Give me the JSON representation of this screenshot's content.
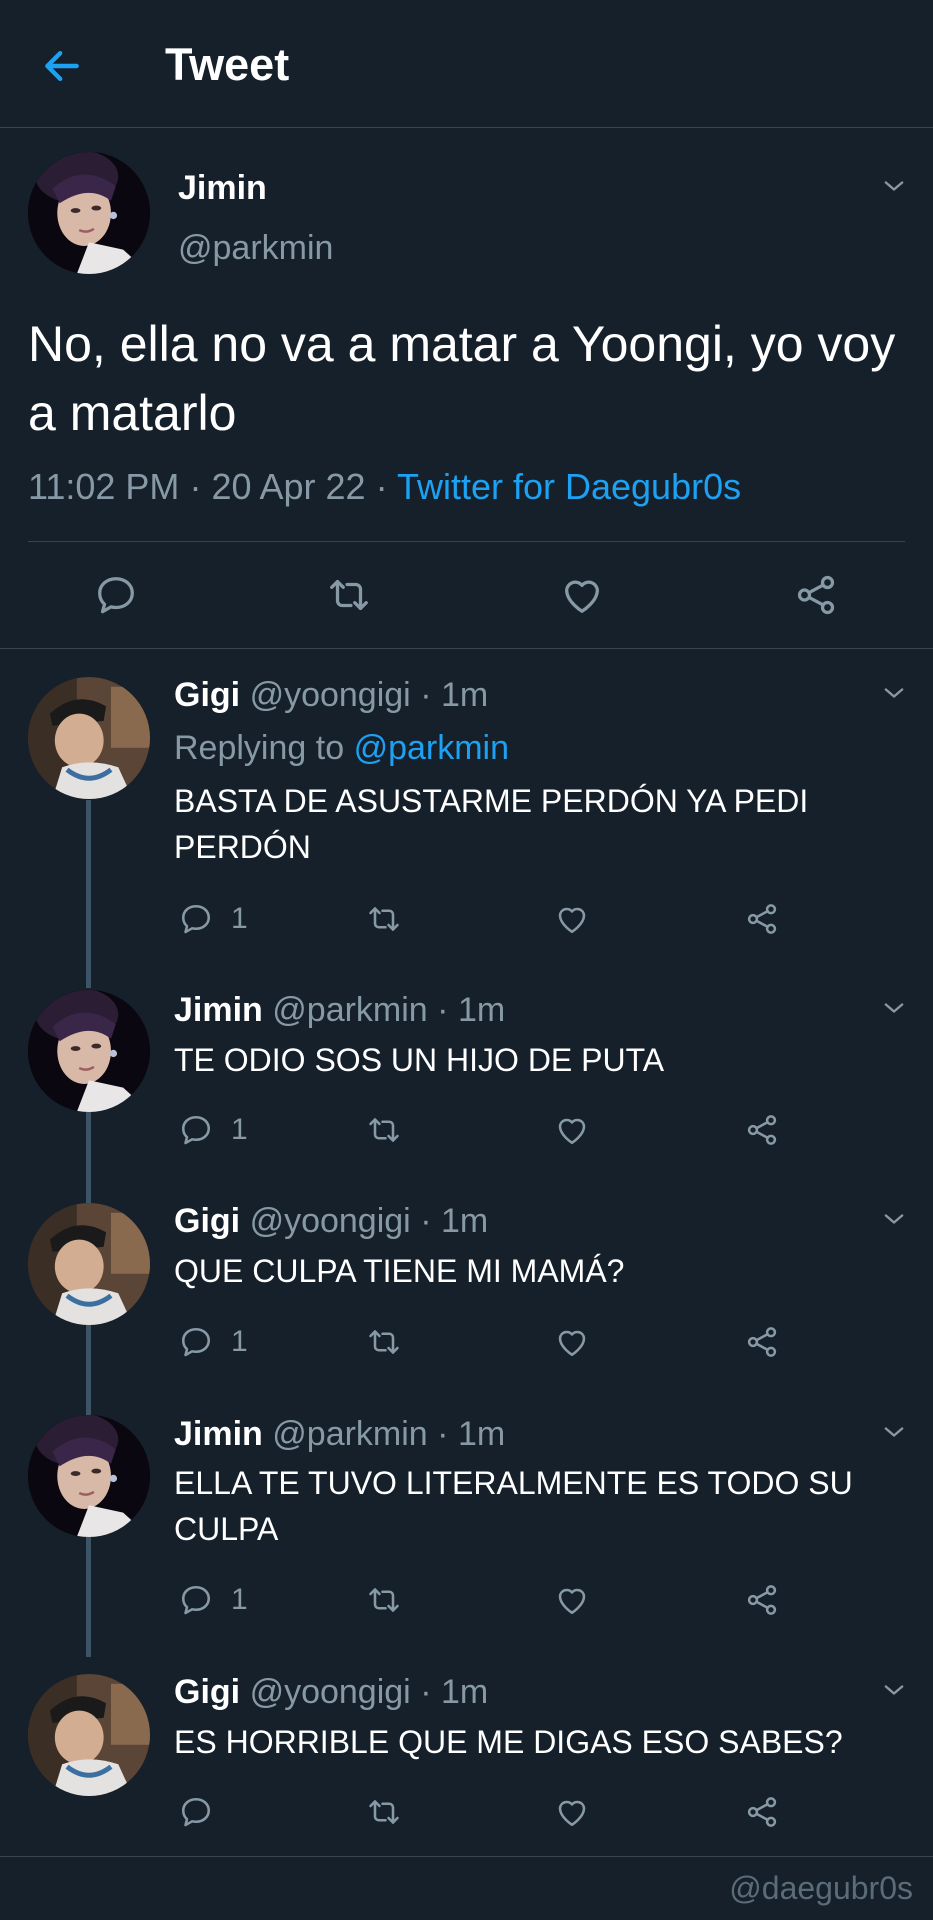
{
  "header": {
    "title": "Tweet"
  },
  "main_tweet": {
    "name": "Jimin",
    "handle": "@parkmin",
    "text": "No, ella no va a matar a Yoongi, yo voy a matarlo",
    "time": "11:02 PM",
    "date": "20 Apr 22",
    "source": "Twitter for Daegubr0s"
  },
  "replies": [
    {
      "name": "Gigi",
      "handle": "@yoongigi",
      "time": "1m",
      "replying_label": "Replying to",
      "replying_handle": "@parkmin",
      "text": "BASTA DE ASUSTARME PERDÓN YA PEDI PERDÓN",
      "reply_count": "1"
    },
    {
      "name": "Jimin",
      "handle": "@parkmin",
      "time": "1m",
      "text": "TE ODIO SOS UN HIJO DE PUTA",
      "reply_count": "1"
    },
    {
      "name": "Gigi",
      "handle": "@yoongigi",
      "time": "1m",
      "text": "QUE CULPA TIENE MI MAMÁ?",
      "reply_count": "1"
    },
    {
      "name": "Jimin",
      "handle": "@parkmin",
      "time": "1m",
      "text": "ELLA TE TUVO LITERALMENTE ES TODO SU CULPA",
      "reply_count": "1"
    },
    {
      "name": "Gigi",
      "handle": "@yoongigi",
      "time": "1m",
      "text": "ES HORRIBLE QUE ME DIGAS ESO SABES?"
    }
  ],
  "separator": "·",
  "watermark": "@daegubr0s",
  "icons": [
    "back-arrow-icon",
    "chevron-down-icon",
    "reply-icon",
    "retweet-icon",
    "like-icon",
    "share-icon"
  ],
  "colors": {
    "background": "#15202b",
    "accent": "#1da1f2",
    "secondary_text": "#8899a6",
    "divider": "#38444d"
  }
}
